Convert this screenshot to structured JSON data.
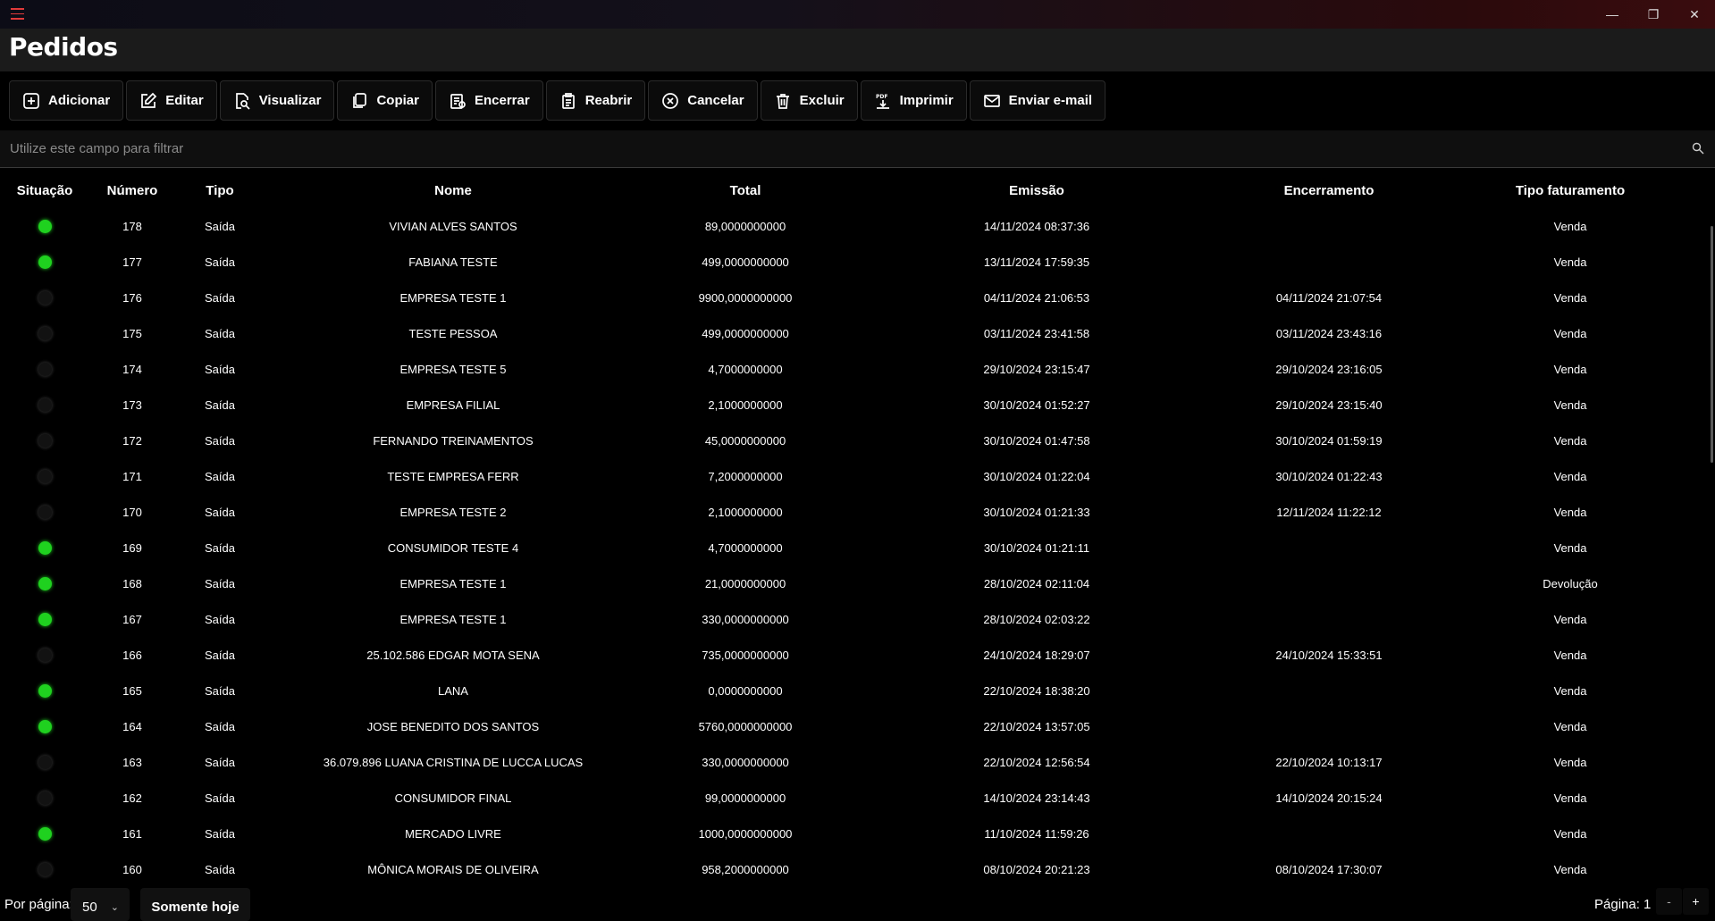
{
  "window": {
    "minimize": "—",
    "restore": "❐",
    "close": "✕"
  },
  "page": {
    "title": "Pedidos"
  },
  "toolbar": [
    {
      "label": "Adicionar",
      "icon": "add-icon"
    },
    {
      "label": "Editar",
      "icon": "edit-icon"
    },
    {
      "label": "Visualizar",
      "icon": "view-icon"
    },
    {
      "label": "Copiar",
      "icon": "copy-icon"
    },
    {
      "label": "Encerrar",
      "icon": "close-order-icon"
    },
    {
      "label": "Reabrir",
      "icon": "reopen-icon"
    },
    {
      "label": "Cancelar",
      "icon": "cancel-icon"
    },
    {
      "label": "Excluir",
      "icon": "trash-icon"
    },
    {
      "label": "Imprimir",
      "icon": "pdf-icon"
    },
    {
      "label": "Enviar e-mail",
      "icon": "mail-icon"
    }
  ],
  "filter": {
    "placeholder": "Utilize este campo para filtrar",
    "value": ""
  },
  "table": {
    "columns": [
      "Situação",
      "Número",
      "Tipo",
      "Nome",
      "Total",
      "Emissão",
      "Encerramento",
      "Tipo faturamento"
    ],
    "rows": [
      {
        "status": "open",
        "numero": "178",
        "tipo": "Saída",
        "nome": "VIVIAN ALVES SANTOS",
        "total": "89,0000000000",
        "emissao": "14/11/2024 08:37:36",
        "encerramento": "",
        "faturamento": "Venda"
      },
      {
        "status": "open",
        "numero": "177",
        "tipo": "Saída",
        "nome": "FABIANA TESTE",
        "total": "499,0000000000",
        "emissao": "13/11/2024 17:59:35",
        "encerramento": "",
        "faturamento": "Venda"
      },
      {
        "status": "closed",
        "numero": "176",
        "tipo": "Saída",
        "nome": "EMPRESA TESTE 1",
        "total": "9900,0000000000",
        "emissao": "04/11/2024 21:06:53",
        "encerramento": "04/11/2024 21:07:54",
        "faturamento": "Venda"
      },
      {
        "status": "closed",
        "numero": "175",
        "tipo": "Saída",
        "nome": "TESTE PESSOA",
        "total": "499,0000000000",
        "emissao": "03/11/2024 23:41:58",
        "encerramento": "03/11/2024 23:43:16",
        "faturamento": "Venda"
      },
      {
        "status": "closed",
        "numero": "174",
        "tipo": "Saída",
        "nome": "EMPRESA TESTE 5",
        "total": "4,7000000000",
        "emissao": "29/10/2024 23:15:47",
        "encerramento": "29/10/2024 23:16:05",
        "faturamento": "Venda"
      },
      {
        "status": "closed",
        "numero": "173",
        "tipo": "Saída",
        "nome": "EMPRESA FILIAL",
        "total": "2,1000000000",
        "emissao": "30/10/2024 01:52:27",
        "encerramento": "29/10/2024 23:15:40",
        "faturamento": "Venda"
      },
      {
        "status": "closed",
        "numero": "172",
        "tipo": "Saída",
        "nome": "FERNANDO TREINAMENTOS",
        "total": "45,0000000000",
        "emissao": "30/10/2024 01:47:58",
        "encerramento": "30/10/2024 01:59:19",
        "faturamento": "Venda"
      },
      {
        "status": "closed",
        "numero": "171",
        "tipo": "Saída",
        "nome": "TESTE EMPRESA FERR",
        "total": "7,2000000000",
        "emissao": "30/10/2024 01:22:04",
        "encerramento": "30/10/2024 01:22:43",
        "faturamento": "Venda"
      },
      {
        "status": "closed",
        "numero": "170",
        "tipo": "Saída",
        "nome": "EMPRESA TESTE 2",
        "total": "2,1000000000",
        "emissao": "30/10/2024 01:21:33",
        "encerramento": "12/11/2024 11:22:12",
        "faturamento": "Venda"
      },
      {
        "status": "open",
        "numero": "169",
        "tipo": "Saída",
        "nome": "CONSUMIDOR TESTE 4",
        "total": "4,7000000000",
        "emissao": "30/10/2024 01:21:11",
        "encerramento": "",
        "faturamento": "Venda"
      },
      {
        "status": "open",
        "numero": "168",
        "tipo": "Saída",
        "nome": "EMPRESA TESTE 1",
        "total": "21,0000000000",
        "emissao": "28/10/2024 02:11:04",
        "encerramento": "",
        "faturamento": "Devolução"
      },
      {
        "status": "open",
        "numero": "167",
        "tipo": "Saída",
        "nome": "EMPRESA TESTE 1",
        "total": "330,0000000000",
        "emissao": "28/10/2024 02:03:22",
        "encerramento": "",
        "faturamento": "Venda"
      },
      {
        "status": "closed",
        "numero": "166",
        "tipo": "Saída",
        "nome": "25.102.586 EDGAR MOTA SENA",
        "total": "735,0000000000",
        "emissao": "24/10/2024 18:29:07",
        "encerramento": "24/10/2024 15:33:51",
        "faturamento": "Venda"
      },
      {
        "status": "open",
        "numero": "165",
        "tipo": "Saída",
        "nome": "LANA",
        "total": "0,0000000000",
        "emissao": "22/10/2024 18:38:20",
        "encerramento": "",
        "faturamento": "Venda"
      },
      {
        "status": "open",
        "numero": "164",
        "tipo": "Saída",
        "nome": "JOSE BENEDITO DOS SANTOS",
        "total": "5760,0000000000",
        "emissao": "22/10/2024 13:57:05",
        "encerramento": "",
        "faturamento": "Venda"
      },
      {
        "status": "closed",
        "numero": "163",
        "tipo": "Saída",
        "nome": "36.079.896 LUANA CRISTINA DE LUCCA LUCAS",
        "total": "330,0000000000",
        "emissao": "22/10/2024 12:56:54",
        "encerramento": "22/10/2024 10:13:17",
        "faturamento": "Venda"
      },
      {
        "status": "closed",
        "numero": "162",
        "tipo": "Saída",
        "nome": "CONSUMIDOR FINAL",
        "total": "99,0000000000",
        "emissao": "14/10/2024 23:14:43",
        "encerramento": "14/10/2024 20:15:24",
        "faturamento": "Venda"
      },
      {
        "status": "open",
        "numero": "161",
        "tipo": "Saída",
        "nome": "MERCADO LIVRE",
        "total": "1000,0000000000",
        "emissao": "11/10/2024 11:59:26",
        "encerramento": "",
        "faturamento": "Venda"
      },
      {
        "status": "closed",
        "numero": "160",
        "tipo": "Saída",
        "nome": "MÔNICA MORAIS DE OLIVEIRA",
        "total": "958,2000000000",
        "emissao": "08/10/2024 20:21:23",
        "encerramento": "08/10/2024 17:30:07",
        "faturamento": "Venda"
      }
    ]
  },
  "footer": {
    "per_page_label": "Por página:",
    "per_page_value": "50",
    "today_button": "Somente hoje",
    "page_label": "Página: 1",
    "prev": "-",
    "next": "+"
  },
  "colors": {
    "status_open": "#1fd11f",
    "status_closed": "#121212",
    "accent": "#e03a3a"
  }
}
